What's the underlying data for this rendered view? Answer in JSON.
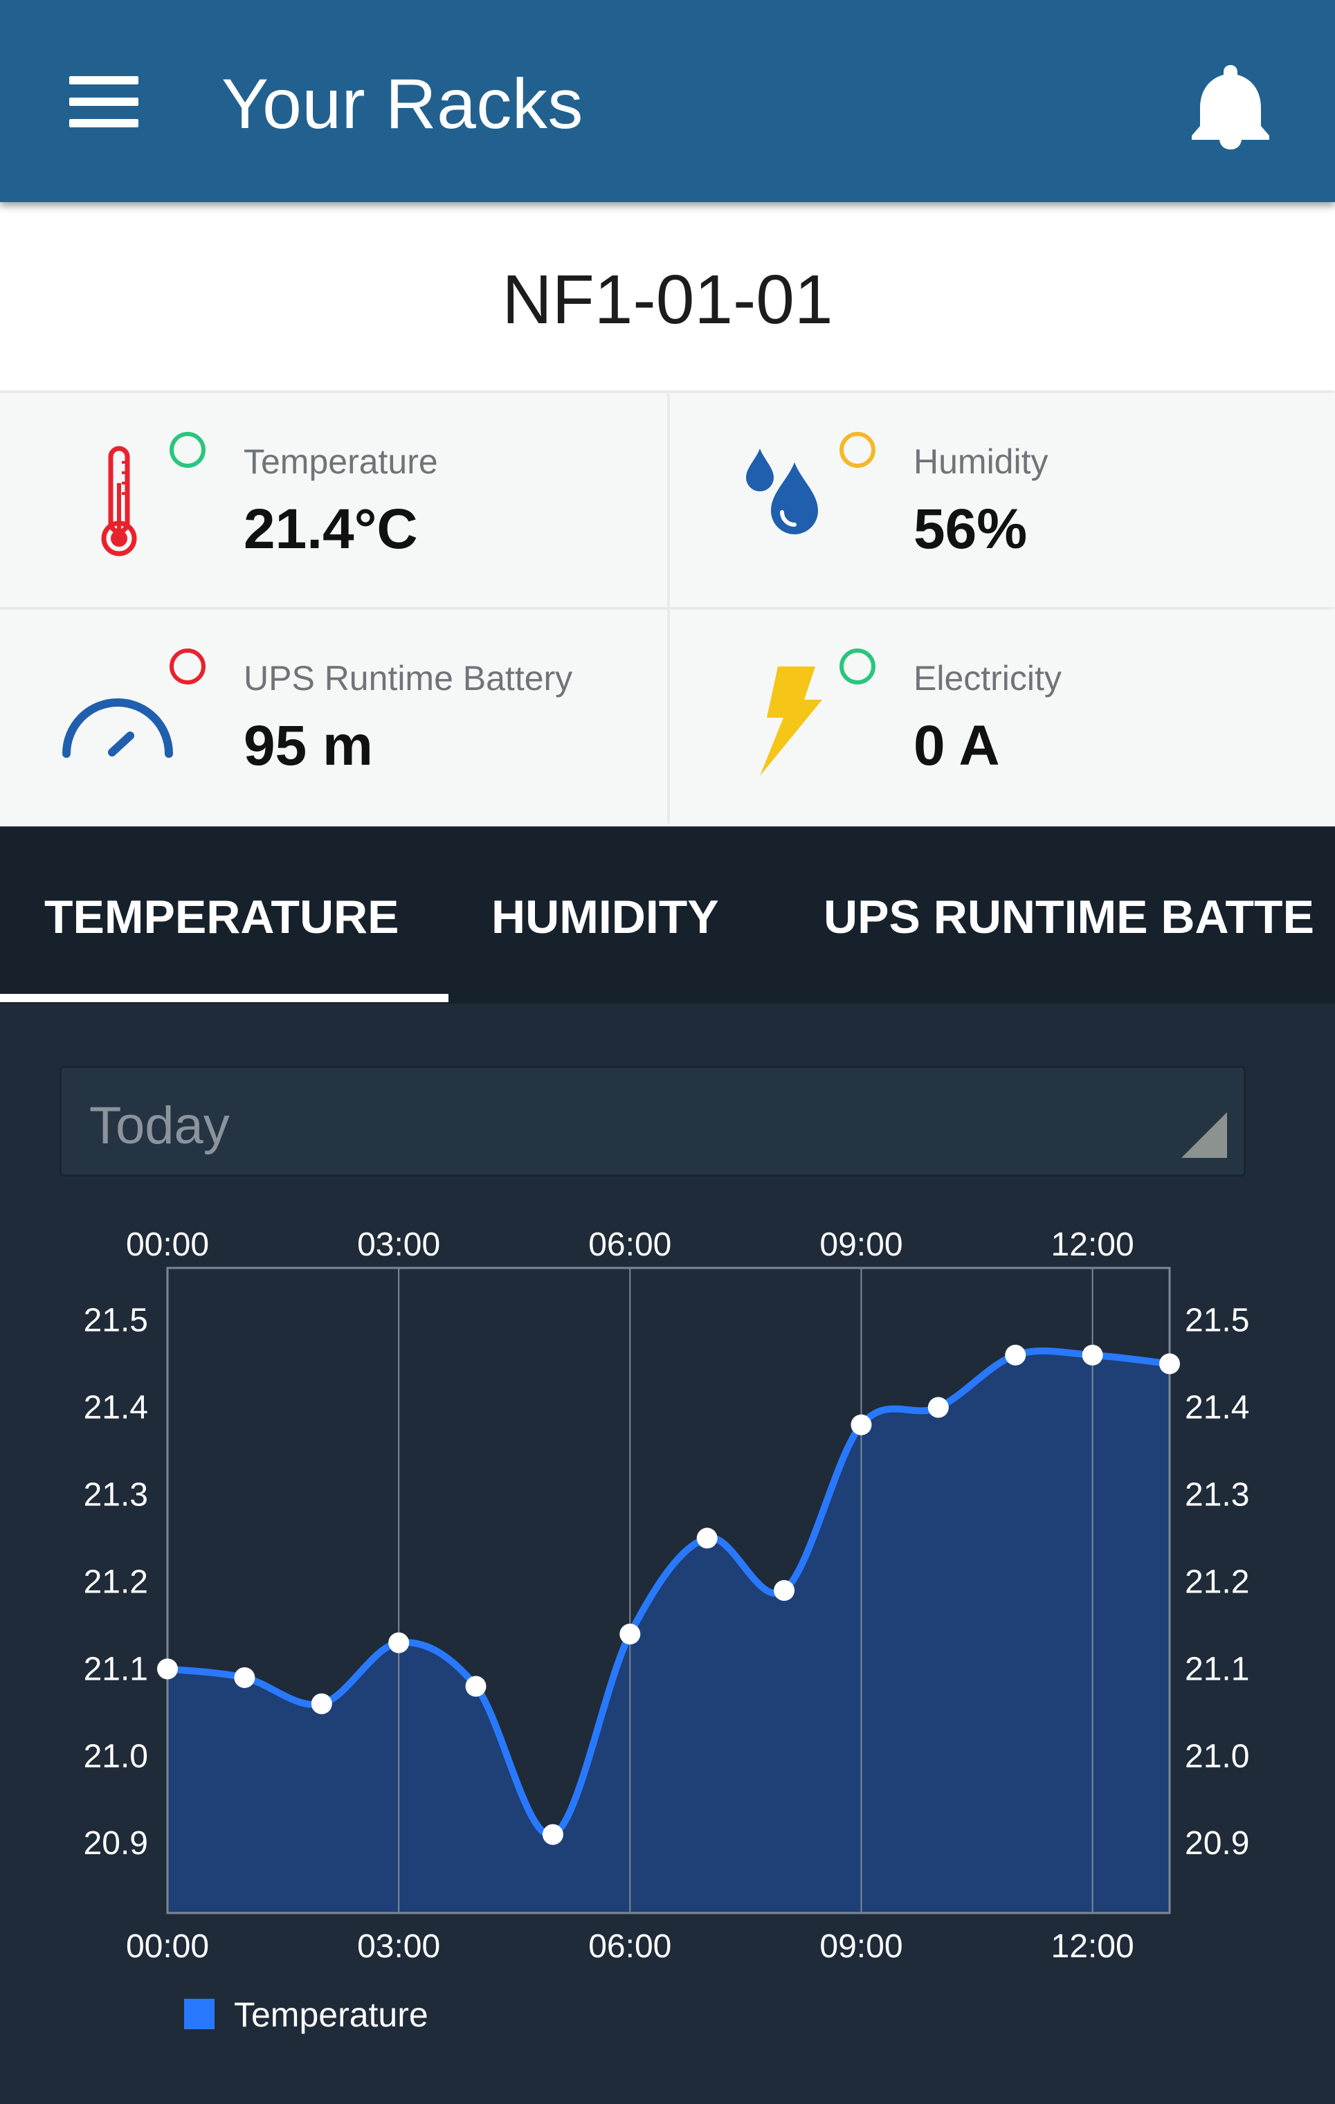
{
  "appbar": {
    "title": "Your Racks",
    "menu_icon": "hamburger-menu-icon",
    "notification_icon": "bell-icon"
  },
  "rack": {
    "name": "NF1-01-01"
  },
  "metrics": [
    {
      "label": "Temperature",
      "value": "21.4°C",
      "icon": "thermometer-icon",
      "status_color": "#2ac57f",
      "icon_color": "#e8222d"
    },
    {
      "label": "Humidity",
      "value": "56%",
      "icon": "water-drops-icon",
      "status_color": "#f5b928",
      "icon_color": "#1f5fae"
    },
    {
      "label": "UPS Runtime Battery",
      "value": "95 m",
      "icon": "gauge-icon",
      "status_color": "#e8222d",
      "icon_color": "#1f5fae"
    },
    {
      "label": "Electricity",
      "value": "0 A",
      "icon": "lightning-bolt-icon",
      "status_color": "#2ac57f",
      "icon_color": "#f5c518"
    }
  ],
  "tabs": [
    {
      "label": "TEMPERATURE",
      "selected": true
    },
    {
      "label": "HUMIDITY",
      "selected": false
    },
    {
      "label": "UPS RUNTIME BATTE",
      "selected": false
    }
  ],
  "range_select": {
    "value": "Today"
  },
  "chart_data": {
    "type": "area",
    "x": [
      "00:00",
      "01:00",
      "02:00",
      "03:00",
      "04:00",
      "05:00",
      "06:00",
      "07:00",
      "08:00",
      "09:00",
      "10:00",
      "11:00",
      "12:00",
      "13:00"
    ],
    "series": [
      {
        "name": "Temperature",
        "values": [
          21.1,
          21.09,
          21.06,
          21.13,
          21.08,
          20.91,
          21.14,
          21.25,
          21.19,
          21.38,
          21.4,
          21.46,
          21.46,
          21.45
        ]
      }
    ],
    "x_ticks": [
      "00:00",
      "03:00",
      "06:00",
      "09:00",
      "12:00"
    ],
    "y_ticks": [
      "20.9",
      "21.0",
      "21.1",
      "21.2",
      "21.3",
      "21.4",
      "21.5"
    ],
    "ylim": [
      20.82,
      21.56
    ],
    "grid": "vertical",
    "legend": "bottom-left",
    "colors": {
      "line": "#2979ff",
      "fill": "#1f3f77",
      "point": "#ffffff"
    }
  }
}
